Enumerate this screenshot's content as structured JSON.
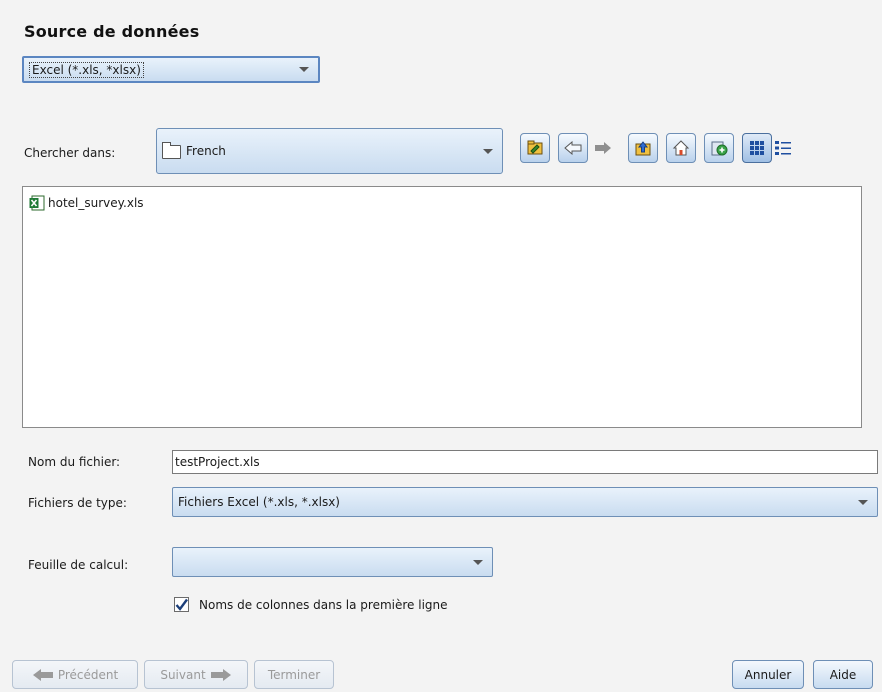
{
  "header": {
    "title": "Source de données"
  },
  "data_source": {
    "selected": "Excel (*.xls, *xlsx)"
  },
  "look_in": {
    "label": "Chercher dans:",
    "folder": "French"
  },
  "toolbar": {
    "icons": [
      "search-folder-icon",
      "back-arrow-icon",
      "forward-arrow-icon",
      "up-folder-icon",
      "home-icon",
      "new-folder-icon",
      "grid-view-icon",
      "details-view-icon"
    ]
  },
  "file_list": {
    "items": [
      {
        "name": "hotel_survey.xls",
        "icon": "excel-file-icon"
      }
    ]
  },
  "filename": {
    "label": "Nom du fichier:",
    "value": "testProject.xls"
  },
  "filetype": {
    "label": "Fichiers de type:",
    "selected": "Fichiers Excel (*.xls, *.xlsx)"
  },
  "sheet": {
    "label": "Feuille de calcul:",
    "selected": ""
  },
  "column_names": {
    "label": "Noms de colonnes dans la première ligne",
    "checked": true
  },
  "footer": {
    "prev_label": "Précédent",
    "next_label": "Suivant",
    "finish_label": "Terminer",
    "cancel_label": "Annuler",
    "help_label": "Aide"
  },
  "colors": {
    "accent": "#5b86c1",
    "button_top": "#f4f8fd",
    "button_bottom": "#c7dbf0",
    "background": "#f3f3f3"
  }
}
